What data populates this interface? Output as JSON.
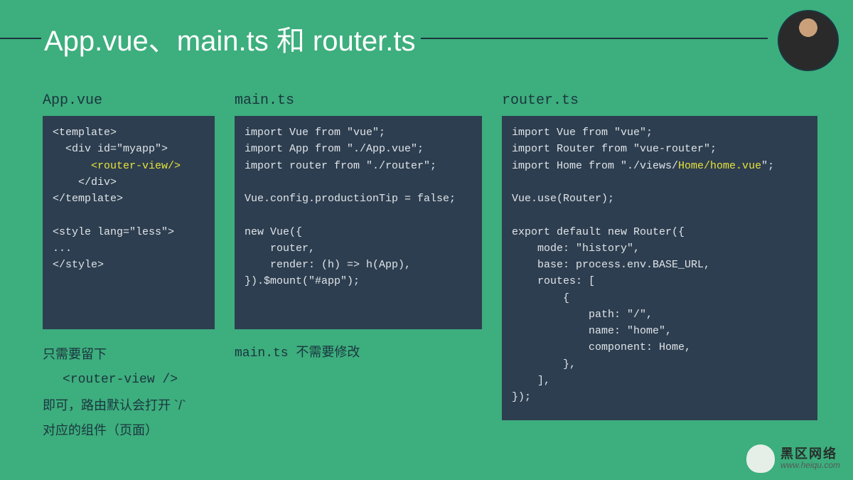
{
  "title": "App.vue、main.ts 和 router.ts",
  "columns": {
    "app": {
      "heading": "App.vue",
      "code_pre": "<template>\n  <div id=\"myapp\">\n      ",
      "code_hl": "<router-view/>",
      "code_post": "\n    </div>\n</template>\n\n<style lang=\"less\">\n...\n</style>",
      "note_l1": "只需要留下",
      "note_code": "<router-view />",
      "note_l2": "即可，路由默认会打开 `/`",
      "note_l3": "对应的组件（页面）"
    },
    "main": {
      "heading": "main.ts",
      "code": "import Vue from \"vue\";\nimport App from \"./App.vue\";\nimport router from \"./router\";\n\nVue.config.productionTip = false;\n\nnew Vue({\n    router,\n    render: (h) => h(App),\n}).$mount(\"#app\");",
      "note_mono": "main.ts ",
      "note_cjk": "不需要修改"
    },
    "router": {
      "heading": "router.ts",
      "code_pre": "import Vue from \"vue\";\nimport Router from \"vue-router\";\nimport Home from \"./views/",
      "code_hl": "Home/home.vue",
      "code_post": "\";\n\nVue.use(Router);\n\nexport default new Router({\n    mode: \"history\",\n    base: process.env.BASE_URL,\n    routes: [\n        {\n            path: \"/\",\n            name: \"home\",\n            component: Home,\n        },\n    ],\n});"
    }
  },
  "watermark": {
    "cn": "黑区网络",
    "en": "www.heiqu.com"
  }
}
